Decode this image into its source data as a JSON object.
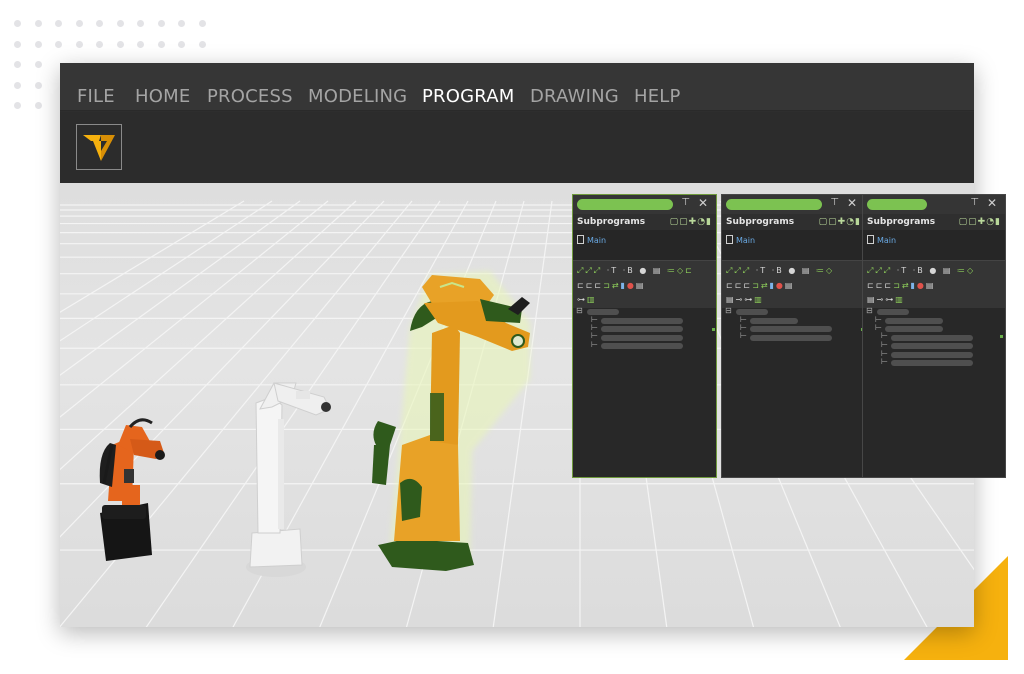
{
  "menu": {
    "items": [
      "FILE",
      "HOME",
      "PROCESS",
      "MODELING",
      "PROGRAM",
      "DRAWING",
      "HELP"
    ],
    "active": "PROGRAM"
  },
  "panels": [
    {
      "heading": "Subprograms",
      "program": "Main",
      "pin": "⊤",
      "close": "✕"
    },
    {
      "heading": "Subprograms",
      "program": "Main",
      "pin": "⊤",
      "close": "✕"
    },
    {
      "heading": "Subprograms",
      "program": "Main",
      "pin": "⊤",
      "close": "✕"
    }
  ],
  "toolbar_glyphs": {
    "tool_t": "T",
    "tool_b": "B"
  },
  "colors": {
    "accent_orange": "#f6b10e",
    "selection_green": "#7cc251",
    "window_dark": "#2e2e2e",
    "robot_orange": "#e5651d",
    "robot_gold": "#e8a227",
    "robot_white": "#f2f2f2"
  },
  "icons": {
    "logo": "visual-components-logo",
    "pin": "pin-icon",
    "close": "close-icon"
  }
}
